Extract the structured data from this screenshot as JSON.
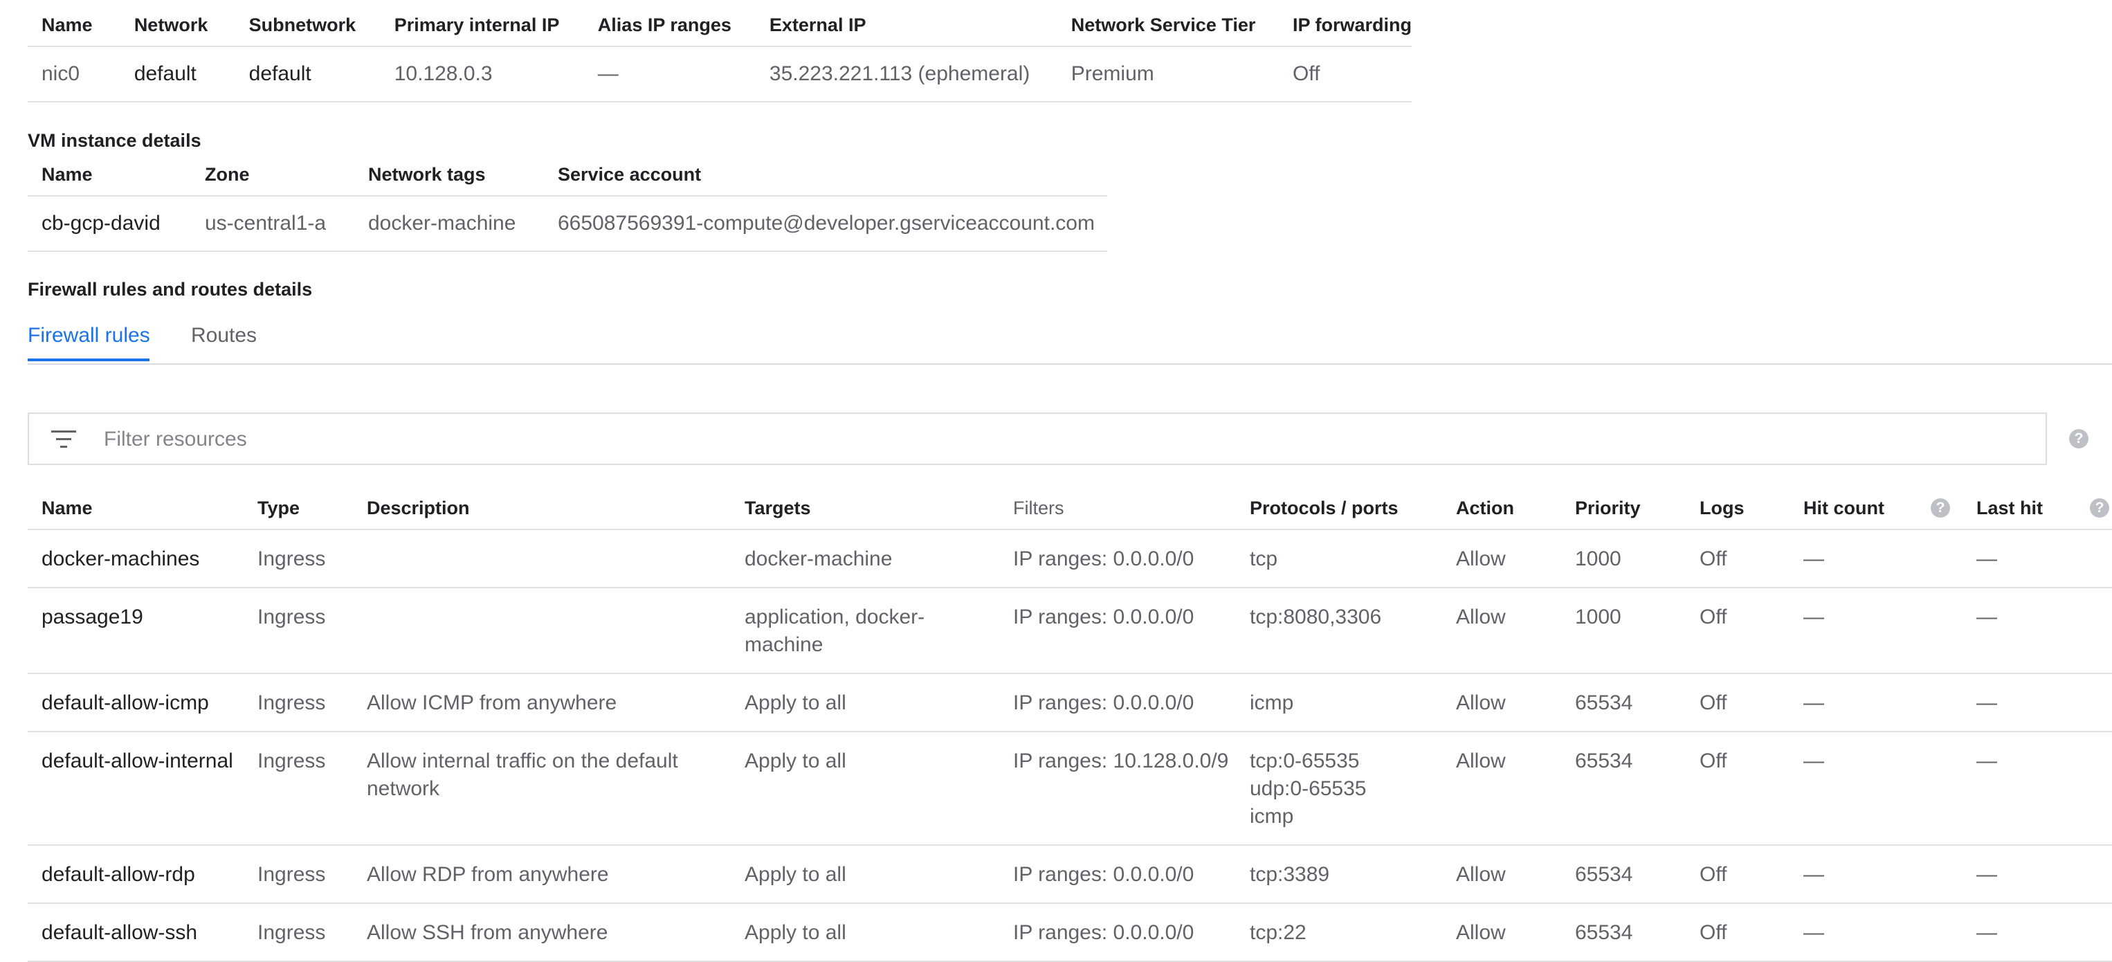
{
  "nic": {
    "headers": [
      "Name",
      "Network",
      "Subnetwork",
      "Primary internal IP",
      "Alias IP ranges",
      "External IP",
      "Network Service Tier",
      "IP forwarding"
    ],
    "row": [
      "nic0",
      "default",
      "default",
      "10.128.0.3",
      "—",
      "35.223.221.113 (ephemeral)",
      "Premium",
      "Off"
    ]
  },
  "vm": {
    "title": "VM instance details",
    "headers": [
      "Name",
      "Zone",
      "Network tags",
      "Service account"
    ],
    "row": [
      "cb-gcp-david",
      "us-central1-a",
      "docker-machine",
      "665087569391-compute@developer.gserviceaccount.com"
    ]
  },
  "firewall_section": {
    "title": "Firewall rules and routes details",
    "tabs": [
      "Firewall rules",
      "Routes"
    ],
    "active_tab": "Firewall rules",
    "filter_placeholder": "Filter resources",
    "help_glyph": "?"
  },
  "firewall": {
    "headers": [
      "Name",
      "Type",
      "Description",
      "Targets",
      "Filters",
      "Protocols / ports",
      "Action",
      "Priority",
      "Logs",
      "Hit count",
      "Last hit"
    ],
    "rows": [
      [
        "docker-machines",
        "Ingress",
        "",
        "docker-machine",
        "IP ranges: 0.0.0.0/0",
        "tcp",
        "Allow",
        "1000",
        "Off",
        "—",
        "—"
      ],
      [
        "passage19",
        "Ingress",
        "",
        "application, docker-machine",
        "IP ranges: 0.0.0.0/0",
        "tcp:8080,3306",
        "Allow",
        "1000",
        "Off",
        "—",
        "—"
      ],
      [
        "default-allow-icmp",
        "Ingress",
        "Allow ICMP from anywhere",
        "Apply to all",
        "IP ranges: 0.0.0.0/0",
        "icmp",
        "Allow",
        "65534",
        "Off",
        "—",
        "—"
      ],
      [
        "default-allow-internal",
        "Ingress",
        "Allow internal traffic on the default network",
        "Apply to all",
        "IP ranges: 10.128.0.0/9",
        "tcp:0-65535\nudp:0-65535\nicmp",
        "Allow",
        "65534",
        "Off",
        "—",
        "—"
      ],
      [
        "default-allow-rdp",
        "Ingress",
        "Allow RDP from anywhere",
        "Apply to all",
        "IP ranges: 0.0.0.0/0",
        "tcp:3389",
        "Allow",
        "65534",
        "Off",
        "—",
        "—"
      ],
      [
        "default-allow-ssh",
        "Ingress",
        "Allow SSH from anywhere",
        "Apply to all",
        "IP ranges: 0.0.0.0/0",
        "tcp:22",
        "Allow",
        "65534",
        "Off",
        "—",
        "—"
      ]
    ]
  },
  "colors": {
    "accent": "#1a73e8",
    "divider": "#e0e0e0",
    "secondary_text": "#5f6368"
  }
}
